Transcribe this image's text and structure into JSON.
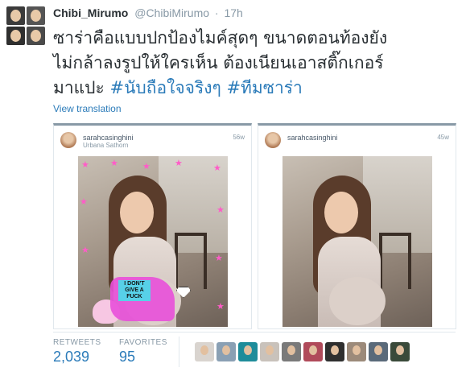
{
  "tweet": {
    "display_name": "Chibi_Mirumo",
    "handle": "@ChibiMirumo",
    "separator": "·",
    "time": "17h",
    "text_line1": "ซาร่าคือแบบปกป้องไมค์สุดๆ ขนาดตอนท้องยัง",
    "text_line2": "ไม่กล้าลงรูปให้ใครเห็น ต้องเนียนเอาสติ๊กเกอร์",
    "text_line3_plain": "มาแปะ ",
    "hashtag1": "#นับถือใจจริงๆ",
    "hashtag2": "#ทีมซาร่า",
    "view_translation": "View translation"
  },
  "cards": [
    {
      "username": "sarahcasinghini",
      "location": "Urbana Sathorn",
      "age": "56w",
      "sticker_text": "I DON'T GIVE A FUCK"
    },
    {
      "username": "sarahcasinghini",
      "location": "",
      "age": "45w"
    }
  ],
  "stats": {
    "retweets_label": "RETWEETS",
    "retweets_value": "2,039",
    "favorites_label": "FAVORITES",
    "favorites_value": "95"
  },
  "colors": {
    "link": "#2b7bb9",
    "muted": "#8899a6",
    "text": "#292f33",
    "border": "#e1e8ed"
  }
}
